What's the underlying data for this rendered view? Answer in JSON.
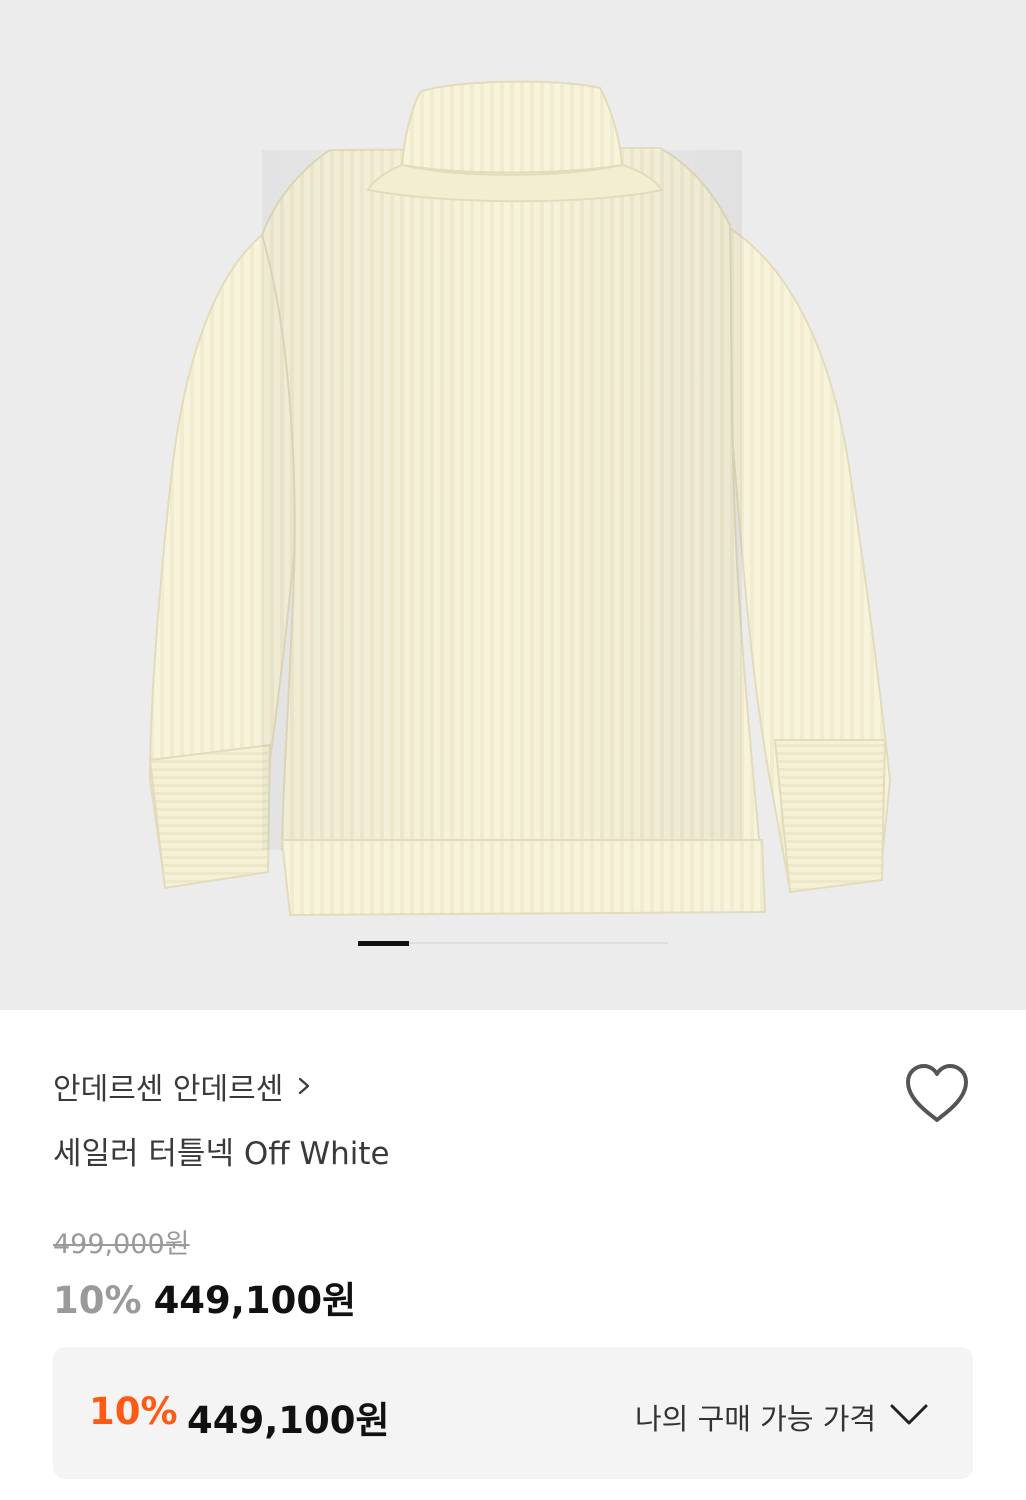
{
  "gallery": {
    "image_alt": "sweater-product-image",
    "current_index": 1,
    "indicator_progress": 0.165
  },
  "product": {
    "brand": "안데르센 안데르센",
    "name": "세일러 터틀넥 Off White",
    "original_price": "499,000원",
    "discount_rate": "10%",
    "sale_price": "449,100원"
  },
  "my_price": {
    "discount_rate": "10%",
    "price": "449,100원",
    "label": "나의 구매 가능 가격"
  },
  "icons": {
    "brand_chevron": "chevron-right-icon",
    "wishlist": "heart-outline-icon",
    "expand": "chevron-down-icon"
  },
  "colors": {
    "gallery_bg": "#ececec",
    "sweater": "#f7f2d8",
    "accent_discount": "#ff5a14",
    "muted_text": "#9a9a9a"
  }
}
